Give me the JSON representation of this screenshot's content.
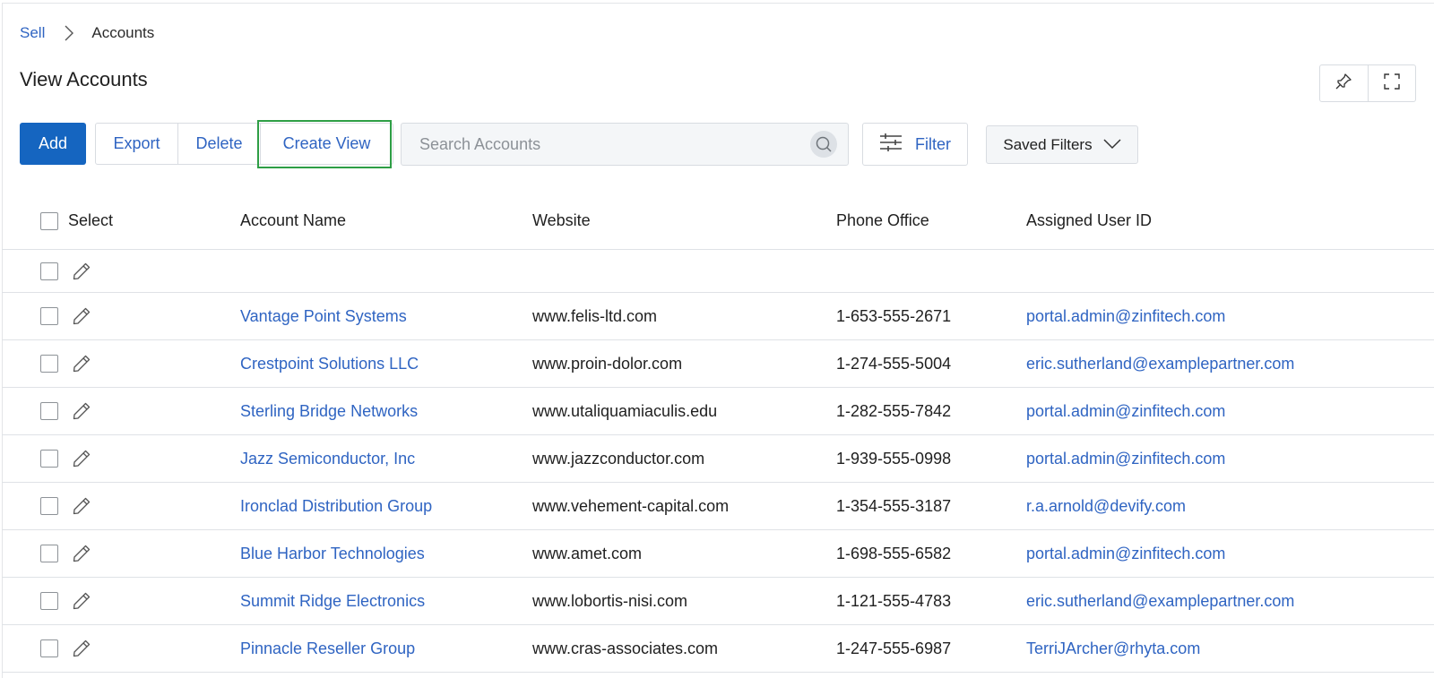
{
  "breadcrumb": {
    "parent": "Sell",
    "current": "Accounts"
  },
  "page_title": "View Accounts",
  "toolbar": {
    "add_label": "Add",
    "export_label": "Export",
    "delete_label": "Delete",
    "create_view_label": "Create View",
    "search_placeholder": "Search Accounts",
    "filter_label": "Filter",
    "saved_filters_label": "Saved Filters"
  },
  "icons": {
    "pin": "pin-icon",
    "fullscreen": "fullscreen-icon",
    "search": "search-icon",
    "filter": "sliders-icon",
    "chevron": "chevron-down-icon",
    "edit": "pencil-icon",
    "breadcrumb_sep": "chevron-right-icon"
  },
  "colors": {
    "accent": "#1565c0",
    "link": "#2f64c2",
    "focus": "#2e9e45"
  },
  "table": {
    "columns": [
      "Select",
      "Account Name",
      "Website",
      "Phone Office",
      "Assigned User ID"
    ],
    "rows": [
      {
        "name": "",
        "website": "",
        "phone": "",
        "user": ""
      },
      {
        "name": "Vantage Point Systems",
        "website": "www.felis-ltd.com",
        "phone": "1-653-555-2671",
        "user": "portal.admin@zinfitech.com"
      },
      {
        "name": "Crestpoint Solutions LLC",
        "website": "www.proin-dolor.com",
        "phone": "1-274-555-5004",
        "user": "eric.sutherland@examplepartner.com"
      },
      {
        "name": "Sterling Bridge Networks",
        "website": "www.utaliquamiaculis.edu",
        "phone": "1-282-555-7842",
        "user": "portal.admin@zinfitech.com"
      },
      {
        "name": "Jazz Semiconductor, Inc",
        "website": "www.jazzconductor.com",
        "phone": "1-939-555-0998",
        "user": "portal.admin@zinfitech.com"
      },
      {
        "name": "Ironclad Distribution Group",
        "website": "www.vehement-capital.com",
        "phone": "1-354-555-3187",
        "user": "r.a.arnold@devify.com"
      },
      {
        "name": "Blue Harbor Technologies",
        "website": "www.amet.com",
        "phone": "1-698-555-6582",
        "user": "portal.admin@zinfitech.com"
      },
      {
        "name": "Summit Ridge Electronics",
        "website": "www.lobortis-nisi.com",
        "phone": "1-121-555-4783",
        "user": "eric.sutherland@examplepartner.com"
      },
      {
        "name": "Pinnacle Reseller Group",
        "website": "www.cras-associates.com",
        "phone": "1-247-555-6987",
        "user": "TerriJArcher@rhyta.com"
      }
    ]
  }
}
